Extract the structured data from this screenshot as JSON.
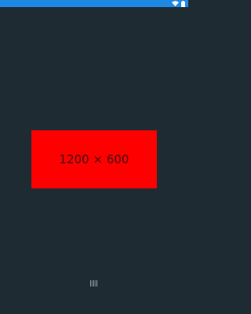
{
  "status_bar": {
    "color": "#1e88e5",
    "icons": [
      "wifi-icon",
      "battery-icon"
    ]
  },
  "main": {
    "background": "#1f2b32",
    "placeholder": {
      "label": "1200 × 600",
      "color": "#ff0000"
    }
  },
  "pager": {
    "icon": "pager-indicator-icon"
  }
}
